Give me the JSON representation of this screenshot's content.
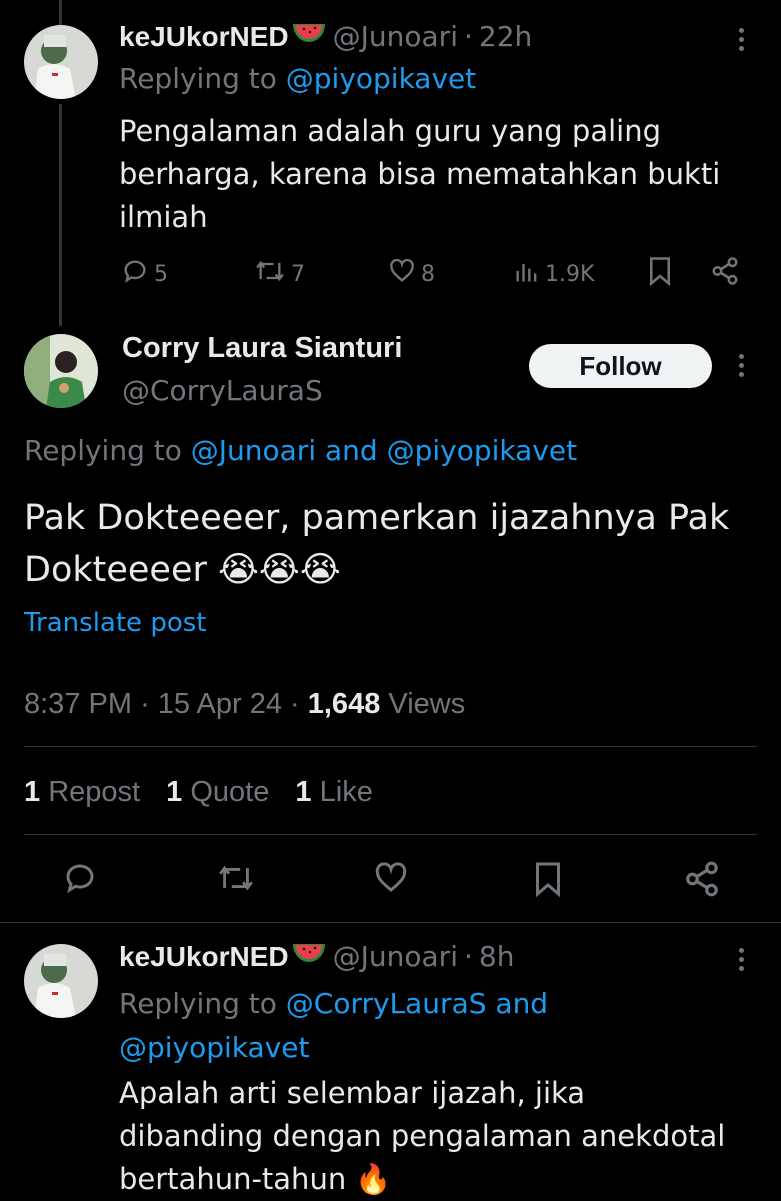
{
  "reply1": {
    "display_name": "keJUkorNED",
    "handle": "@Junoari",
    "time": "22h",
    "replying_prefix": "Replying to",
    "replying_to": "@piyopikavet",
    "text_lines": [
      "Pengalaman adalah guru yang paling",
      "berharga, karena bisa mematahkan bukti",
      "ilmiah"
    ],
    "replies": "5",
    "reposts": "7",
    "likes": "8",
    "views": "1.9K"
  },
  "main": {
    "display_name": "Corry Laura Sianturi",
    "handle": "@CorryLauraS",
    "follow_label": "Follow",
    "replying_prefix": "Replying to",
    "replying_to_1": "@Junoari",
    "replying_and": "and",
    "replying_to_2": "@piyopikavet",
    "text_line1": "Pak Dokteeeer, pamerkan ijazahnya Pak",
    "text_line2": "Dokteeeer",
    "emojis": "😭😭😭",
    "translate": "Translate post",
    "time": "8:37 PM",
    "date": "15 Apr 24",
    "views_count": "1,648",
    "views_label": "Views",
    "repost_count": "1",
    "repost_label": "Repost",
    "quote_count": "1",
    "quote_label": "Quote",
    "like_count": "1",
    "like_label": "Like"
  },
  "reply2": {
    "display_name": "keJUkorNED",
    "handle": "@Junoari",
    "time": "8h",
    "replying_prefix": "Replying to",
    "replying_to_1": "@CorryLauraS",
    "replying_and": "and",
    "replying_to_2": "@piyopikavet",
    "text_lines": [
      "Apalah arti selembar ijazah, jika",
      "dibanding dengan pengalaman anekdotal",
      "bertahun-tahun"
    ],
    "emoji": "🔥"
  },
  "separator": "·",
  "colors": {
    "background": "#000000",
    "text": "#e7e9ea",
    "muted": "#71767b",
    "link": "#1d9bf0",
    "divider": "#2f3336"
  },
  "icons": [
    "reply-icon",
    "repost-icon",
    "like-icon",
    "views-icon",
    "bookmark-icon",
    "share-icon",
    "more-icon",
    "watermelon-icon"
  ]
}
